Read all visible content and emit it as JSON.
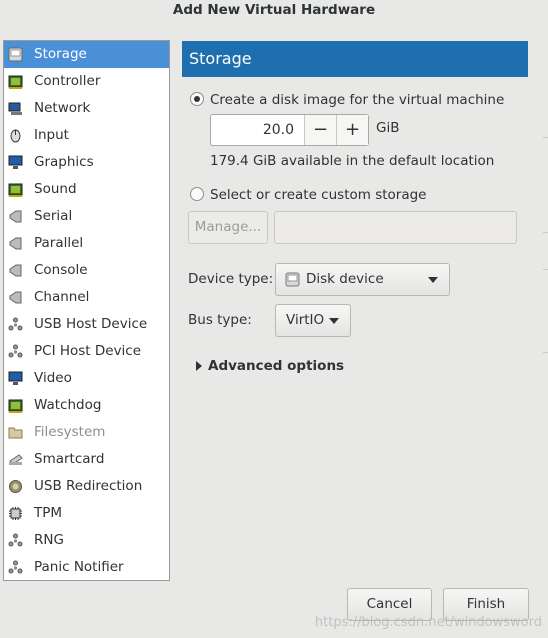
{
  "window": {
    "title": "Add New Virtual Hardware"
  },
  "sidebar": {
    "items": [
      {
        "label": "Storage",
        "icon": "disk-icon",
        "selected": true,
        "enabled": true
      },
      {
        "label": "Controller",
        "icon": "chip-icon",
        "selected": false,
        "enabled": true
      },
      {
        "label": "Network",
        "icon": "network-icon",
        "selected": false,
        "enabled": true
      },
      {
        "label": "Input",
        "icon": "mouse-icon",
        "selected": false,
        "enabled": true
      },
      {
        "label": "Graphics",
        "icon": "monitor-icon",
        "selected": false,
        "enabled": true
      },
      {
        "label": "Sound",
        "icon": "chip-icon",
        "selected": false,
        "enabled": true
      },
      {
        "label": "Serial",
        "icon": "port-icon",
        "selected": false,
        "enabled": true
      },
      {
        "label": "Parallel",
        "icon": "port-icon",
        "selected": false,
        "enabled": true
      },
      {
        "label": "Console",
        "icon": "port-icon",
        "selected": false,
        "enabled": true
      },
      {
        "label": "Channel",
        "icon": "port-icon",
        "selected": false,
        "enabled": true
      },
      {
        "label": "USB Host Device",
        "icon": "device-tree-icon",
        "selected": false,
        "enabled": true
      },
      {
        "label": "PCI Host Device",
        "icon": "device-tree-icon",
        "selected": false,
        "enabled": true
      },
      {
        "label": "Video",
        "icon": "monitor-icon",
        "selected": false,
        "enabled": true
      },
      {
        "label": "Watchdog",
        "icon": "chip-icon",
        "selected": false,
        "enabled": true
      },
      {
        "label": "Filesystem",
        "icon": "folder-icon",
        "selected": false,
        "enabled": false
      },
      {
        "label": "Smartcard",
        "icon": "smartcard-icon",
        "selected": false,
        "enabled": true
      },
      {
        "label": "USB Redirection",
        "icon": "usb-redirect-icon",
        "selected": false,
        "enabled": true
      },
      {
        "label": "TPM",
        "icon": "cpu-icon",
        "selected": false,
        "enabled": true
      },
      {
        "label": "RNG",
        "icon": "device-tree-icon",
        "selected": false,
        "enabled": true
      },
      {
        "label": "Panic Notifier",
        "icon": "device-tree-icon",
        "selected": false,
        "enabled": true
      }
    ]
  },
  "main": {
    "header": "Storage",
    "create_disk": {
      "label": "Create a disk image for the virtual machine",
      "checked": true,
      "size_value": "20.0",
      "minus_label": "−",
      "plus_label": "+",
      "unit": "GiB",
      "available_text": "179.4 GiB available in the default location"
    },
    "custom_storage": {
      "label": "Select or create custom storage",
      "checked": false,
      "manage_label": "Manage...",
      "path_value": ""
    },
    "device_type": {
      "label": "Device type:",
      "value": "Disk device",
      "icon": "disk-icon"
    },
    "bus_type": {
      "label": "Bus type:",
      "value": "VirtIO"
    },
    "advanced": {
      "label": "Advanced options",
      "expanded": false
    }
  },
  "footer": {
    "cancel_label": "Cancel",
    "finish_label": "Finish"
  },
  "watermark": "https://blog.csdn.net/windowsword",
  "colors": {
    "selection": "#4a90d9",
    "header": "#1e6fb0"
  }
}
